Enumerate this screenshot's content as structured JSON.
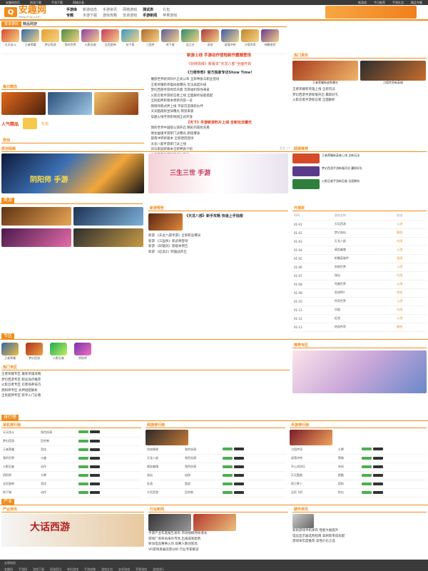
{
  "topbar": {
    "left": [
      "安趣网首页",
      "网游下载",
      "手游下载",
      "网络分类"
    ],
    "right": [
      "新游戏",
      "今日推荐",
      "手游礼包",
      "精品专题"
    ]
  },
  "logo": {
    "mark": "Q",
    "title": "安趣网",
    "url": "www.anqu.com"
  },
  "nav": {
    "items": [
      "手游库",
      "新游动态",
      "手游资讯",
      "网络游戏",
      "测试表",
      "礼包",
      "专题",
      "手游下载",
      "游戏攻略",
      "安卓游戏",
      "手游新闻",
      "苹果游戏"
    ]
  },
  "tabs": {
    "hot": "安卓游戏",
    "rec": "精品网游"
  },
  "games_row": [
    "天天炫斗",
    "王者荣耀",
    "梦幻西游",
    "我的世界",
    "火影忍者",
    "全民超神",
    "花千骨",
    "三国杀",
    "地下城",
    "龙之谷",
    "奇迹",
    "部落冲突",
    "刀塔传奇",
    "神雕侠侣"
  ],
  "center_news": {
    "head1": "新游上线  手游动作冒险新作震撼登场",
    "head2": "《剑侠情缘》新版本“天龙八部”全面开启",
    "head3": "《刀塔传奇》官方独家专访Show Time!",
    "items": [
      "魔兽世界新资料片正式公布 全新种族与职业登场",
      "王者荣耀新英雄技能曝光 玩法再度升级",
      "梦幻西游手游周年庆典 丰厚福利等你来拿",
      "火影忍者手游新忍者上线 全面解析技能搭配",
      "全民超神新版本更新内容一览",
      "阴阳师新式神上线 平安京迎来新伙伴",
      "天天酷跑新坐骑曝光 萌宠来袭",
      "穿越火线手游新地图正式开放"
    ],
    "head4": "《天下》手游新资料片上线 全新玩法曝光",
    "items2": [
      "我的世界中国版公测开启 精彩内容抢先看",
      "倩女幽魂手游新门派曝光 颜值爆表",
      "部落冲突新版本 全新建筑登场",
      "天龙八部手游新门派上线",
      "剑与家园新版本全新种族介绍",
      "大话西游手游新年活动开启",
      "奇迹暖暖新套装曝光 美出新高度"
    ]
  },
  "right_news": {
    "title": "热门资讯",
    "caps": [
      "王者荣耀新皮肤曝光",
      "刀塔传奇新英雄"
    ],
    "links": [
      "王者荣耀新英雄上线 全新玩法",
      "梦幻西游手游新服开启 赢取好礼",
      "火影忍者手游新忍者 全面解析"
    ]
  },
  "left_mid": {
    "title": "每日精选",
    "label1": "人气精品",
    "label2": "礼包"
  },
  "sections": {
    "s1": "原创",
    "s2": "原创视频",
    "s3": "网游推荐",
    "s4": "新游",
    "s5": "新游预告",
    "s6": "开测表",
    "s7": "专区",
    "s8": "热门专区",
    "s9": "推荐专区",
    "s10": "排行榜",
    "s11": "单机排行榜",
    "s12": "网游排行榜",
    "s13": "手游排行榜",
    "s14": "产业",
    "s15": "产业资讯",
    "s16": "行业新闻",
    "s17": "硬件资讯",
    "more": "更多 >>"
  },
  "video": {
    "caption": "阴阳师 手游",
    "banner": "三生三世 手游"
  },
  "test_table": {
    "cols": [
      "时间",
      "游戏名称",
      "状态"
    ],
    "rows": [
      [
        "01-01",
        "大话西游",
        "公测"
      ],
      [
        "01-02",
        "梦幻诛仙",
        "删档"
      ],
      [
        "01-03",
        "天龙八部",
        "内测"
      ],
      [
        "01-04",
        "倩女幽魂",
        "公测"
      ],
      [
        "01-05",
        "射雕英雄传",
        "首测"
      ],
      [
        "01-06",
        "剑侠世界",
        "公测"
      ],
      [
        "01-07",
        "诛仙",
        "内测"
      ],
      [
        "01-08",
        "完美世界",
        "公测"
      ],
      [
        "01-09",
        "奇迹MU",
        "首发"
      ],
      [
        "01-10",
        "传奇世界",
        "公测"
      ],
      [
        "01-11",
        "问道",
        "内测"
      ],
      [
        "01-12",
        "征途",
        "公测"
      ],
      [
        "01-13",
        "热血传奇",
        "删档"
      ]
    ]
  },
  "newgames": {
    "headline": "《天龙八部》新手攻略 快速上手指南",
    "items": [
      "新游 《天龙八部手游》全新职业曝光",
      "新游 《三国杀》新武将登场",
      "新游 《轩辕剑》新版本预告",
      "新游 《征途2》跨服战开启"
    ]
  },
  "zone": {
    "icons": [
      "王者荣耀",
      "梦幻西游",
      "火影忍者",
      "阴阳师"
    ],
    "items": [
      "王者荣耀专区 最新英雄攻略",
      "梦幻西游专区 职业加点推荐",
      "火影忍者专区 忍者培养技巧",
      "阴阳师专区 式神搭配解析",
      "全民超神专区 新手入门必看"
    ]
  },
  "ranks": {
    "single": [
      [
        "天天炫斗",
        "角色扮演"
      ],
      [
        "梦幻西游",
        "回合制"
      ],
      [
        "王者荣耀",
        "竞技"
      ],
      [
        "我的世界",
        "沙盒"
      ],
      [
        "火影忍者",
        "动作"
      ],
      [
        "阴阳师",
        "卡牌"
      ],
      [
        "全民超神",
        "竞技"
      ],
      [
        "地下城",
        "动作"
      ]
    ],
    "online": [
      [
        "剑侠情缘",
        "角色扮演"
      ],
      [
        "天龙八部",
        "角色扮演"
      ],
      [
        "倩女幽魂",
        "角色扮演"
      ],
      [
        "诛仙",
        "仙侠"
      ],
      [
        "征途",
        "国战"
      ],
      [
        "大话西游",
        "回合制"
      ]
    ],
    "mobile": [
      [
        "刀塔传奇",
        "卡牌"
      ],
      [
        "部落冲突",
        "策略"
      ],
      [
        "开心消消乐",
        "休闲"
      ],
      [
        "天天酷跑",
        "跑酷"
      ],
      [
        "保卫萝卜",
        "塔防"
      ],
      [
        "全民飞机",
        "射击"
      ]
    ]
  },
  "industry": {
    "banner": "大话西游",
    "lines": [
      "手游产业年度报告发布 市场规模持续增长",
      "游戏厂商布局海外市场 出海成新趋势",
      "移动电竞赛事火热 观赛人数创新高",
      "VR游戏发展前景分析 行业专家解读"
    ],
    "hw": [
      "新款游戏手机发布 性能大幅提升",
      "电竞显示器选购指南 高刷新率成标配",
      "游戏本年度推荐 高性价比之选"
    ]
  },
  "footer": {
    "title": "友情链接",
    "links": [
      "安趣网",
      "手游网",
      "游戏下载",
      "网游资讯",
      "单机游戏",
      "手游攻略",
      "游戏礼包",
      "安卓游戏",
      "苹果游戏",
      "游戏排行"
    ]
  },
  "colors": {
    "accent": "#f28c1b",
    "dark": "#3a3a3a"
  }
}
